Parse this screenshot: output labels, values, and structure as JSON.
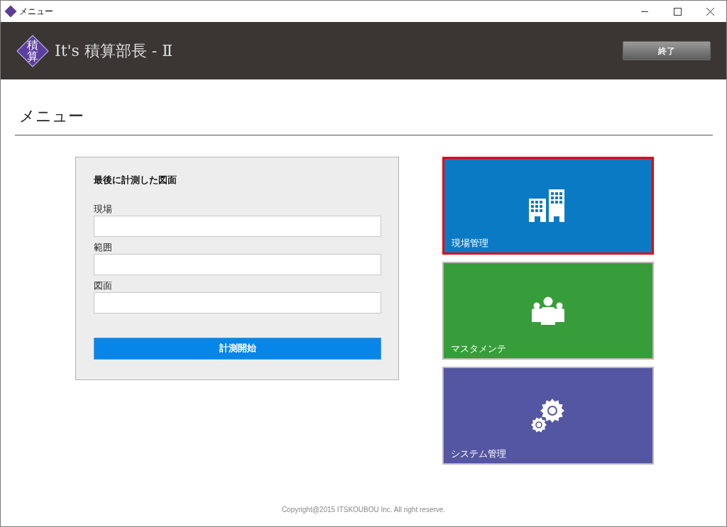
{
  "window": {
    "title": "メニュー"
  },
  "header": {
    "logo_top": "積",
    "logo_bottom": "算",
    "app_name": "It's 積算部長 - Ⅱ",
    "exit_button": "終了"
  },
  "page_title": "メニュー",
  "last_drawing": {
    "title": "最後に計測した図面",
    "fields": [
      {
        "label": "現場"
      },
      {
        "label": "範囲"
      },
      {
        "label": "図面"
      }
    ],
    "start_button": "計測開始"
  },
  "tiles": [
    {
      "label": "現場管理",
      "kind": "buildings",
      "color": "#0b7ac4",
      "selected": true
    },
    {
      "label": "マスタメンテ",
      "kind": "people",
      "color": "#379d3a",
      "selected": false
    },
    {
      "label": "システム管理",
      "kind": "gears",
      "color": "#5456a3",
      "selected": false
    }
  ],
  "footer": "Copyright@2015 ITSKOUBOU Inc. All right reserve."
}
